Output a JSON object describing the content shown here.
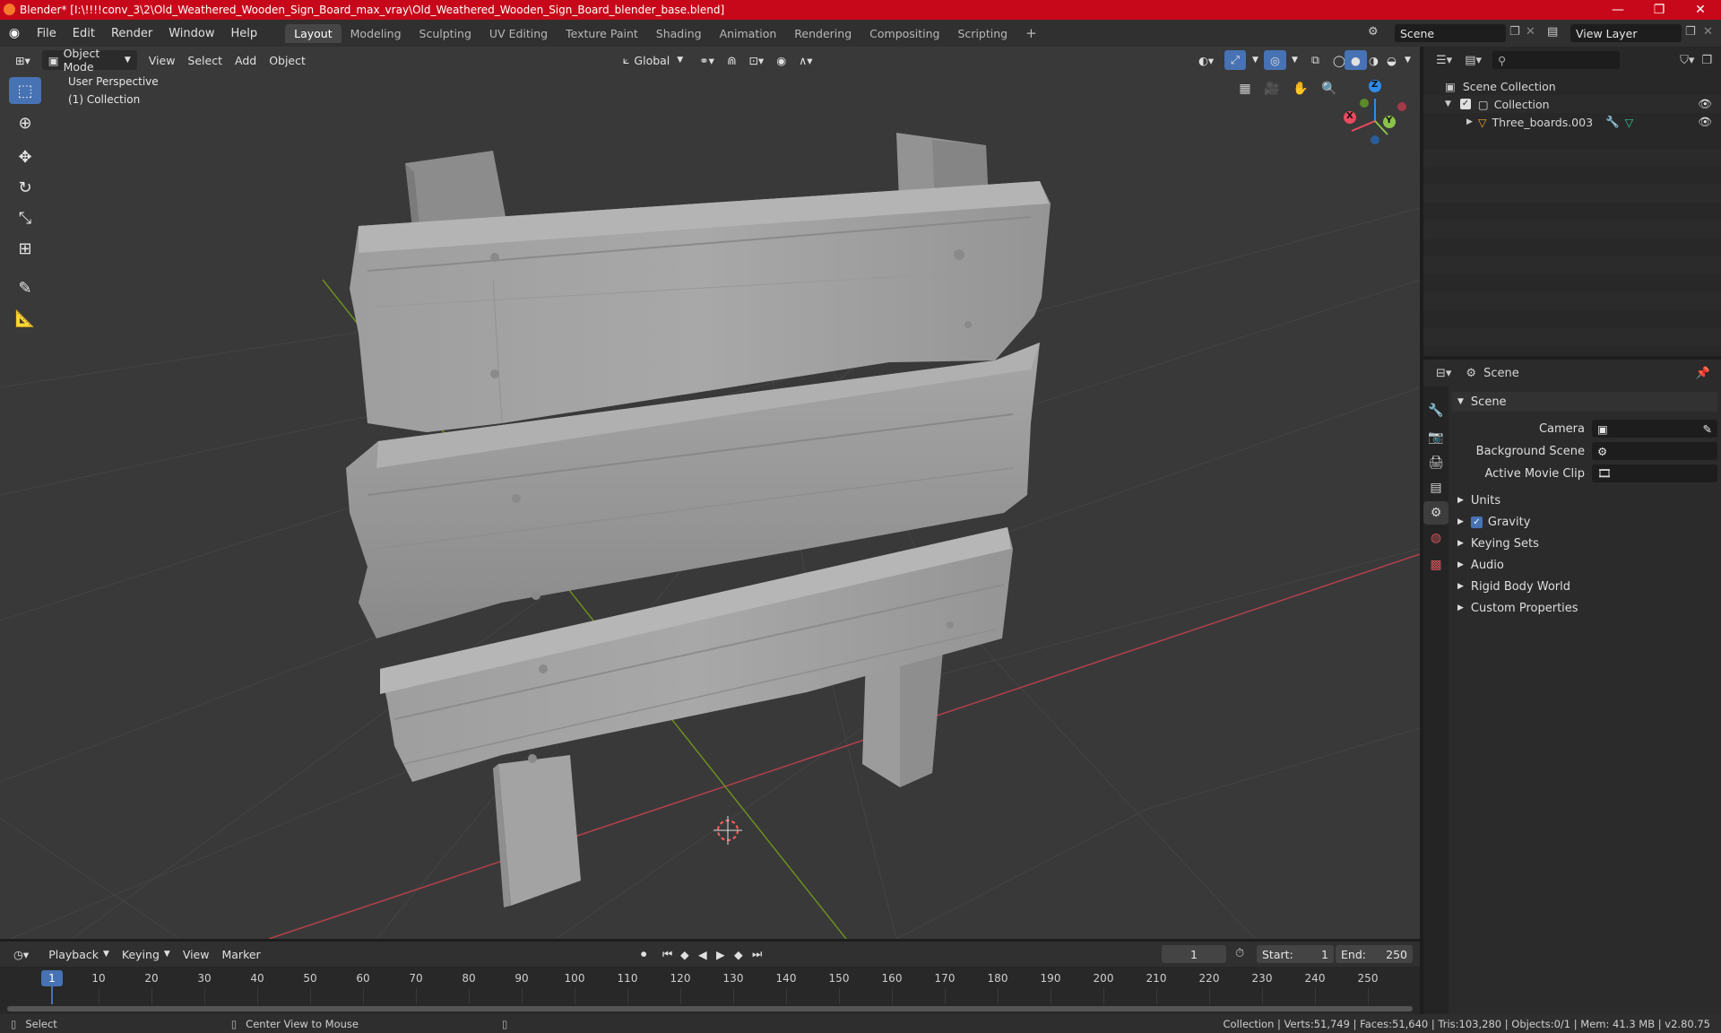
{
  "titlebar": {
    "title": "Blender* [I:\\!!!!conv_3\\2\\Old_Weathered_Wooden_Sign_Board_max_vray\\Old_Weathered_Wooden_Sign_Board_blender_base.blend]",
    "minimize": "—",
    "maximize": "❐",
    "close": "✕"
  },
  "menu": {
    "items": [
      "File",
      "Edit",
      "Render",
      "Window",
      "Help"
    ]
  },
  "workspaces": {
    "tabs": [
      "Layout",
      "Modeling",
      "Sculpting",
      "UV Editing",
      "Texture Paint",
      "Shading",
      "Animation",
      "Rendering",
      "Compositing",
      "Scripting"
    ],
    "active": "Layout",
    "add": "+"
  },
  "scene_selector": {
    "value": "Scene"
  },
  "viewlayer_selector": {
    "value": "View Layer"
  },
  "viewport": {
    "mode": "Object Mode",
    "menus": [
      "View",
      "Select",
      "Add",
      "Object"
    ],
    "orientation": "Global",
    "overlay_line1": "User Perspective",
    "overlay_line2": "(1) Collection",
    "gizmo": {
      "x": "X",
      "y": "Y",
      "z": "Z"
    }
  },
  "outliner": {
    "search_placeholder": "",
    "root": "Scene Collection",
    "collection": "Collection",
    "object": "Three_boards.003"
  },
  "properties": {
    "header": "Scene",
    "panel": "Scene",
    "camera_label": "Camera",
    "background_label": "Background Scene",
    "movieclip_label": "Active Movie Clip",
    "sections": [
      "Units",
      "Gravity",
      "Keying Sets",
      "Audio",
      "Rigid Body World",
      "Custom Properties"
    ],
    "gravity_checked": true
  },
  "timeline": {
    "menus": [
      "Playback",
      "Keying",
      "View",
      "Marker"
    ],
    "current_frame": "1",
    "start_label": "Start:",
    "start_value": "1",
    "end_label": "End:",
    "end_value": "250",
    "ticks": [
      "1",
      "10",
      "20",
      "30",
      "40",
      "50",
      "60",
      "70",
      "80",
      "90",
      "100",
      "110",
      "120",
      "130",
      "140",
      "150",
      "160",
      "170",
      "180",
      "190",
      "200",
      "210",
      "220",
      "230",
      "240",
      "250"
    ]
  },
  "status": {
    "select": "Select",
    "center": "Center View to Mouse",
    "stats": "Collection | Verts:51,749 | Faces:51,640 | Tris:103,280 | Objects:0/1 | Mem: 41.3 MB | v2.80.75"
  },
  "colors": {
    "titlebar": "#c7081a",
    "accent": "#4772b3",
    "x_axis": "#e84a5f",
    "y_axis": "#8bc34a",
    "z_axis": "#2d8ceb"
  }
}
